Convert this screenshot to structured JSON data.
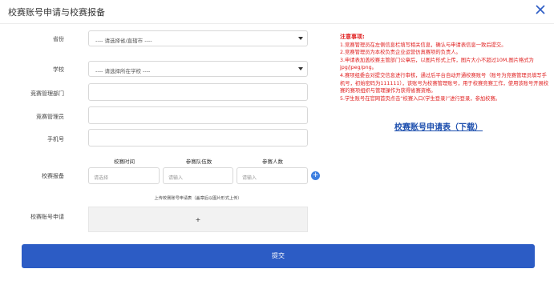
{
  "dialog": {
    "title": "校赛账号申请与校赛报备",
    "close_icon": "close-icon"
  },
  "form": {
    "province": {
      "label": "省份",
      "value": "---- 请选择省/直辖市 ----"
    },
    "school": {
      "label": "学校",
      "value": "---- 请选择所在学校 ----"
    },
    "dept": {
      "label": "竞赛管理部门",
      "value": ""
    },
    "manager": {
      "label": "竞赛管理员",
      "value": ""
    },
    "phone": {
      "label": "手机号",
      "value": ""
    },
    "report": {
      "label": "校赛报备",
      "col_time": "校赛时间",
      "col_teams": "参赛队伍数",
      "col_people": "参赛人数",
      "time_placeholder": "请选择",
      "teams_placeholder": "请输入",
      "people_placeholder": "请输入",
      "add_icon": "plus-circle-icon"
    },
    "apply": {
      "label": "校赛账号申请",
      "upload_tip": "上传校赛账号申请表（盖章后以图片形式上传）",
      "upload_plus": "+"
    }
  },
  "notes": {
    "heading": "注意事项:",
    "items": [
      "1.竞赛管理员在左侧信息栏填写相关信息，确认与申请表信息一致后提交。",
      "2.竞赛管理员为本校负责企业运营仿真赛项的负责人。",
      "3.申请表加盖校赛主管部门公章后，以图片形式上传，图片大小不超过10M,图片格式为jpg/jpeg/png。",
      "4.赛项组委会对提交信息进行审核，通过后平台自动开通校赛账号（账号为竞赛管理员填写手机号，初始密码为111111），该账号为校赛管理账号，用于校赛竞赛工作，使用该账号开展校赛的赛项组织与管理操作为获得省赛资格。",
      "5.学生账号在官网首页点击“校赛入口(学生登录)”进行登录，参加校赛。"
    ],
    "download_link": "校赛账号申请表（下载）"
  },
  "submit_label": "提交",
  "colors": {
    "primary": "#2c5cc5",
    "notes_red": "#e02020",
    "link_blue": "#1d4fae"
  }
}
